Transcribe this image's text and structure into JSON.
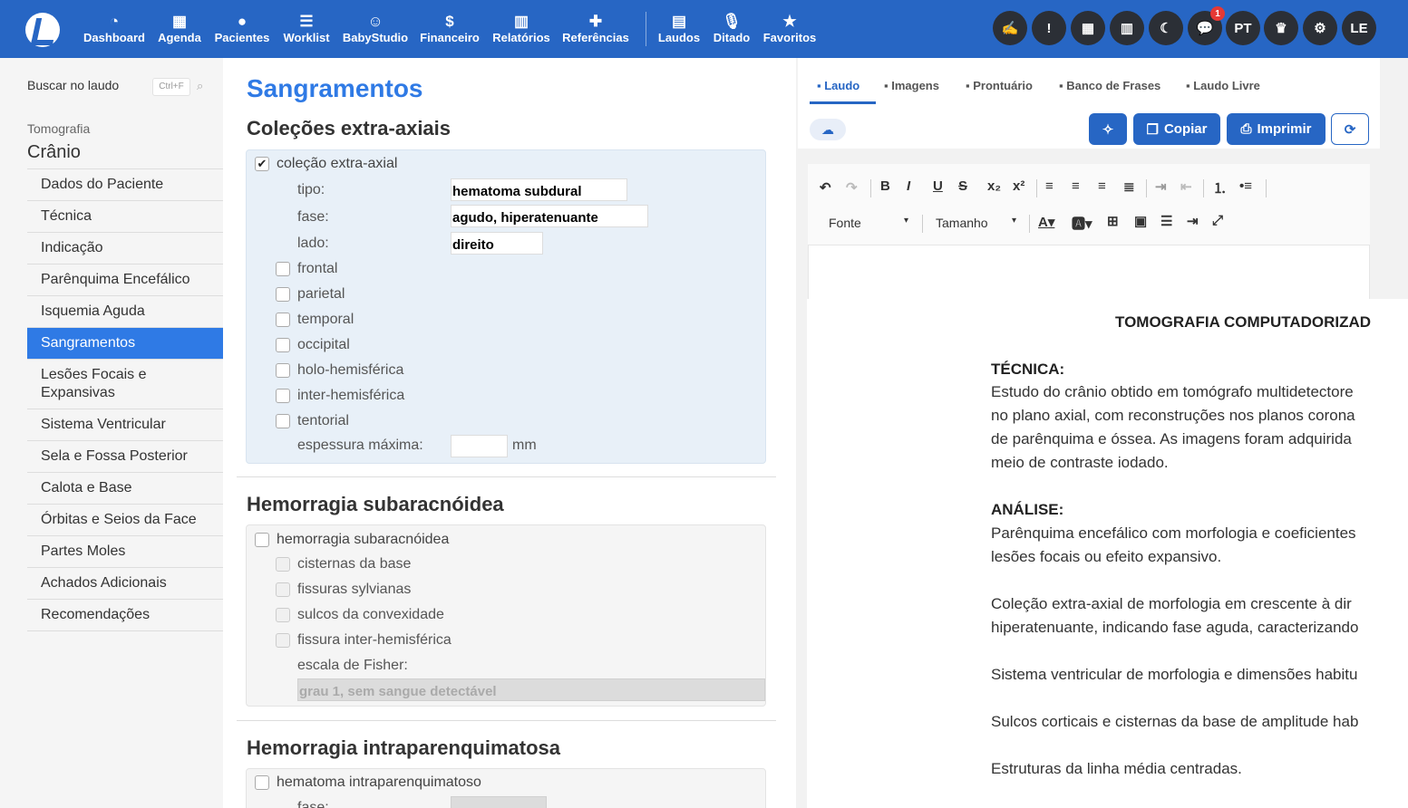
{
  "topnav": {
    "items": [
      {
        "label": "Dashboard",
        "icon": "dashboard-icon",
        "glyph": "◔"
      },
      {
        "label": "Agenda",
        "icon": "calendar-icon",
        "glyph": "▦"
      },
      {
        "label": "Pacientes",
        "icon": "user-icon",
        "glyph": "●"
      },
      {
        "label": "Worklist",
        "icon": "checklist-icon",
        "glyph": "☰"
      },
      {
        "label": "BabyStudio",
        "icon": "baby-icon",
        "glyph": "☺"
      },
      {
        "label": "Financeiro",
        "icon": "dollar-icon",
        "glyph": "$"
      },
      {
        "label": "Relatórios",
        "icon": "bar-chart-icon",
        "glyph": "▥"
      },
      {
        "label": "Referências",
        "icon": "medical-book-icon",
        "glyph": "✚"
      },
      {
        "label": "Laudos",
        "icon": "file-icon",
        "glyph": "▤"
      },
      {
        "label": "Ditado",
        "icon": "microphone-icon",
        "glyph": "🎙"
      },
      {
        "label": "Favoritos",
        "icon": "star-icon",
        "glyph": "★"
      }
    ],
    "circle_buttons": [
      {
        "name": "signature-icon",
        "glyph": "✍"
      },
      {
        "name": "alert-icon",
        "glyph": "!"
      },
      {
        "name": "calendar-icon",
        "glyph": "▦"
      },
      {
        "name": "building-icon",
        "glyph": "▥"
      },
      {
        "name": "moon-icon",
        "glyph": "☾"
      },
      {
        "name": "chat-icon",
        "glyph": "💬",
        "badge": "1"
      },
      {
        "name": "language-button",
        "glyph": "PT"
      },
      {
        "name": "crown-icon",
        "glyph": "♛"
      },
      {
        "name": "gear-icon",
        "glyph": "⚙"
      },
      {
        "name": "user-avatar",
        "glyph": "LE"
      }
    ]
  },
  "sidebar": {
    "search_label": "Buscar no laudo",
    "shortcut": "Ctrl+F",
    "modality": "Tomografia",
    "region": "Crânio",
    "items": [
      "Dados do Paciente",
      "Técnica",
      "Indicação",
      "Parênquima Encefálico",
      "Isquemia Aguda",
      "Sangramentos",
      "Lesões Focais e Expansivas",
      "Sistema Ventricular",
      "Sela e Fossa Posterior",
      "Calota e Base",
      "Órbitas e Seios da Face",
      "Partes Moles",
      "Achados Adicionais",
      "Recomendações"
    ],
    "active_index": 5
  },
  "form": {
    "title": "Sangramentos",
    "colecoes": {
      "heading": "Coleções extra-axiais",
      "main_checkbox": "coleção extra-axial",
      "main_checked": true,
      "tipo_label": "tipo:",
      "tipo_value": "hematoma subdural",
      "fase_label": "fase:",
      "fase_value": "agudo, hiperatenuante",
      "lado_label": "lado:",
      "lado_value": "direito",
      "locations": [
        "frontal",
        "parietal",
        "temporal",
        "occipital",
        "holo-hemisférica",
        "inter-hemisférica",
        "tentorial"
      ],
      "espessura_label": "espessura máxima:",
      "espessura_value": "",
      "espessura_unit": "mm"
    },
    "hsa": {
      "heading": "Hemorragia subaracnóidea",
      "main_checkbox": "hemorragia subaracnóidea",
      "locations": [
        "cisternas da base",
        "fissuras sylvianas",
        "sulcos da convexidade",
        "fissura inter-hemisférica"
      ],
      "fisher_label": "escala de Fisher:",
      "fisher_value": "grau 1, sem sangue detectável"
    },
    "hip": {
      "heading": "Hemorragia intraparenquimatosa",
      "main_checkbox": "hematoma intraparenquimatoso",
      "fase_label": "fase:"
    }
  },
  "editor": {
    "tabs": [
      {
        "label": "Laudo",
        "icon": "file-icon"
      },
      {
        "label": "Imagens",
        "icon": "images-icon"
      },
      {
        "label": "Prontuário",
        "icon": "records-icon"
      },
      {
        "label": "Banco de Frases",
        "icon": "quote-icon"
      },
      {
        "label": "Laudo Livre",
        "icon": "pen-icon"
      }
    ],
    "buttons": {
      "copy": "Copiar",
      "print": "Imprimir"
    },
    "font_select": "Fonte",
    "size_select": "Tamanho",
    "doc": {
      "title": "TOMOGRAFIA COMPUTADORIZAD",
      "tecnica_h": "TÉCNICA:",
      "tecnica_lines": [
        "Estudo do crânio obtido em tomógrafo multidetectore",
        "no plano axial, com reconstruções nos planos corona",
        "de parênquima e óssea. As imagens foram adquirida",
        "meio de contraste iodado."
      ],
      "analise_h": "ANÁLISE:",
      "analise_lines": [
        "Parênquima encefálico com morfologia e coeficientes",
        "lesões focais ou efeito expansivo."
      ],
      "p3_lines": [
        "Coleção extra-axial de morfologia em crescente à dir",
        "hiperatenuante, indicando fase aguda, caracterizando"
      ],
      "p4": "Sistema ventricular de morfologia e dimensões habitu",
      "p5": "Sulcos corticais e cisternas da base de amplitude hab",
      "p6": "Estruturas da linha média centradas."
    }
  }
}
